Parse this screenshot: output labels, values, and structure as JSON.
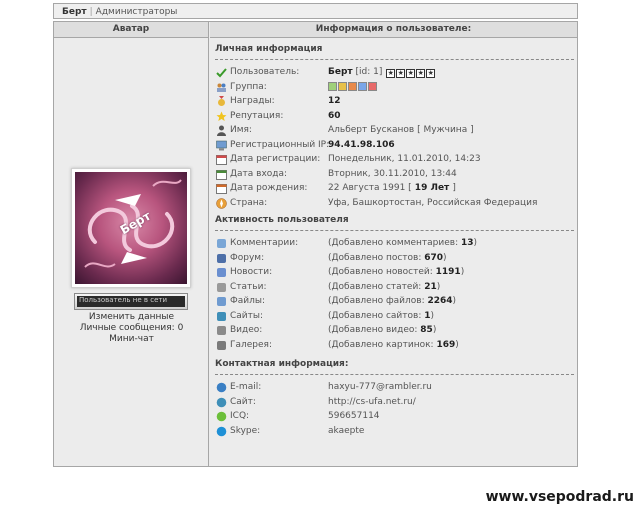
{
  "breadcrumb": {
    "user": "Берт",
    "separator": "|",
    "section": "Администраторы"
  },
  "left": {
    "header": "Аватар",
    "avatar_name": "Берт",
    "status_text": "Пользователь не в сети",
    "links": [
      "Изменить данные",
      "Личные сообщения: 0",
      "Мини-чат"
    ]
  },
  "right": {
    "header": "Информация о пользователе:",
    "personal": {
      "title": "Личная информация",
      "user_label": "Пользователь:",
      "user_name": "Берт",
      "user_id": "[id: 1]",
      "stars": 5,
      "group_label": "Группа:",
      "awards_label": "Награды:",
      "awards": "12",
      "reputation_label": "Репутация:",
      "reputation": "60",
      "name_label": "Имя:",
      "name": "Альберт Бусканов [ Мужчина ]",
      "ip_label": "Регистрационный IP:",
      "ip": "94.41.98.106",
      "regdate_label": "Дата регистрации:",
      "regdate": "Понедельник, 11.01.2010, 14:23",
      "login_label": "Дата входа:",
      "login": "Вторник, 30.11.2010, 13:44",
      "birth_label": "Дата рождения:",
      "birth_pre": "22 Августа 1991 [",
      "birth_age": " 19 Лет ",
      "birth_post": "]",
      "country_label": "Страна:",
      "country": "Уфа, Башкортостан, Российская Федерация"
    },
    "activity": {
      "title": "Активность пользователя",
      "rows": [
        {
          "label": "Комментарии:",
          "text": "(Добавлено комментариев: ",
          "count": "13",
          "icon": "comments-icon",
          "color": "#7aa6d6"
        },
        {
          "label": "Форум:",
          "text": "(Добавлено постов: ",
          "count": "670",
          "icon": "forum-icon",
          "color": "#4d6fa8"
        },
        {
          "label": "Новости:",
          "text": "(Добавлено новостей: ",
          "count": "1191",
          "icon": "news-icon",
          "color": "#6a8fd0"
        },
        {
          "label": "Статьи:",
          "text": "(Добавлено статей: ",
          "count": "21",
          "icon": "articles-icon",
          "color": "#9a9a9a"
        },
        {
          "label": "Файлы:",
          "text": "(Добавлено файлов: ",
          "count": "2264",
          "icon": "files-icon",
          "color": "#6f9bd0"
        },
        {
          "label": "Сайты:",
          "text": "(Добавлено сайтов: ",
          "count": "1",
          "icon": "sites-icon",
          "color": "#3f8fb8"
        },
        {
          "label": "Видео:",
          "text": "(Добавлено видео: ",
          "count": "85",
          "icon": "video-icon",
          "color": "#8a8a8a"
        },
        {
          "label": "Галерея:",
          "text": "(Добавлено картинок: ",
          "count": "169",
          "icon": "gallery-icon",
          "color": "#7a7a7a"
        }
      ],
      "close": ")"
    },
    "contact": {
      "title": "Контактная информация:",
      "rows": [
        {
          "label": "E-mail:",
          "value": "haxyu-777@rambler.ru",
          "icon": "email-icon",
          "color": "#3a7fc4"
        },
        {
          "label": "Сайт:",
          "value": "http://cs-ufa.net.ru/",
          "icon": "website-icon",
          "color": "#3f8fb8"
        },
        {
          "label": "ICQ:",
          "value": "596657114",
          "icon": "icq-icon",
          "color": "#6cbf3a"
        },
        {
          "label": "Skype:",
          "value": "akaepte",
          "icon": "skype-icon",
          "color": "#1e90d6"
        }
      ]
    }
  },
  "watermark": "www.vsepodrad.ru"
}
